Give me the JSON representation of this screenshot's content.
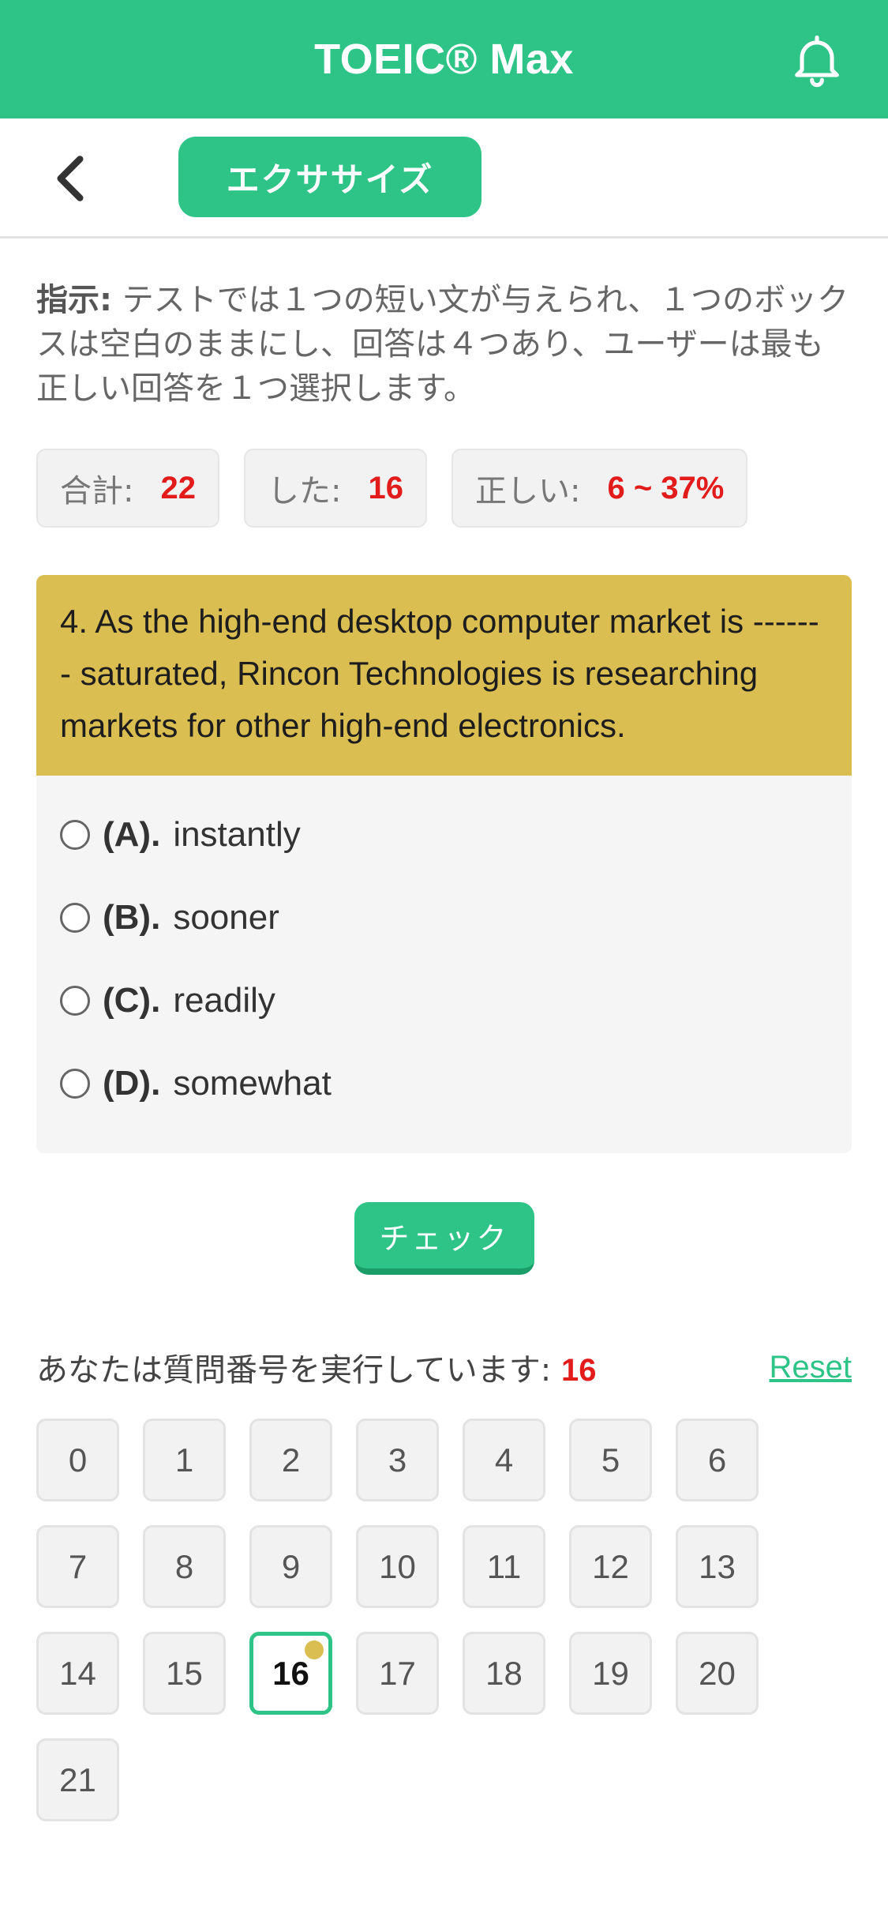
{
  "header": {
    "title": "TOEIC® Max",
    "bell_icon": "bell-icon"
  },
  "subbar": {
    "back_icon": "chevron-left-icon",
    "exercise_label": "エクササイズ"
  },
  "instruction": {
    "label": "指示:",
    "text": " テストでは１つの短い文が与えられ、１つのボックスは空白のままにし、回答は４つあり、ユーザーは最も正しい回答を１つ選択します。"
  },
  "stats": {
    "total_label": "合計:",
    "total_value": "22",
    "done_label": "した:",
    "done_value": "16",
    "correct_label": "正しい:",
    "correct_value": "6 ~ 37%"
  },
  "question": {
    "text": "4. As the high-end desktop computer market is ------- saturated, Rincon Technologies is researching markets for other high-end electronics.",
    "options": [
      {
        "letter": "(A).",
        "text": "instantly"
      },
      {
        "letter": "(B).",
        "text": "sooner"
      },
      {
        "letter": "(C).",
        "text": "readily"
      },
      {
        "letter": "(D).",
        "text": "somewhat"
      }
    ]
  },
  "check_label": "チェック",
  "progress": {
    "label": "あなたは質問番号を実行しています:",
    "current": "16",
    "reset_label": "Reset"
  },
  "question_numbers": [
    "0",
    "1",
    "2",
    "3",
    "4",
    "5",
    "6",
    "7",
    "8",
    "9",
    "10",
    "11",
    "12",
    "13",
    "14",
    "15",
    "16",
    "17",
    "18",
    "19",
    "20",
    "21"
  ],
  "active_question": "16",
  "colors": {
    "brand": "#2ec487",
    "question_bg": "#dbbe52",
    "highlight": "#e21b1b"
  }
}
